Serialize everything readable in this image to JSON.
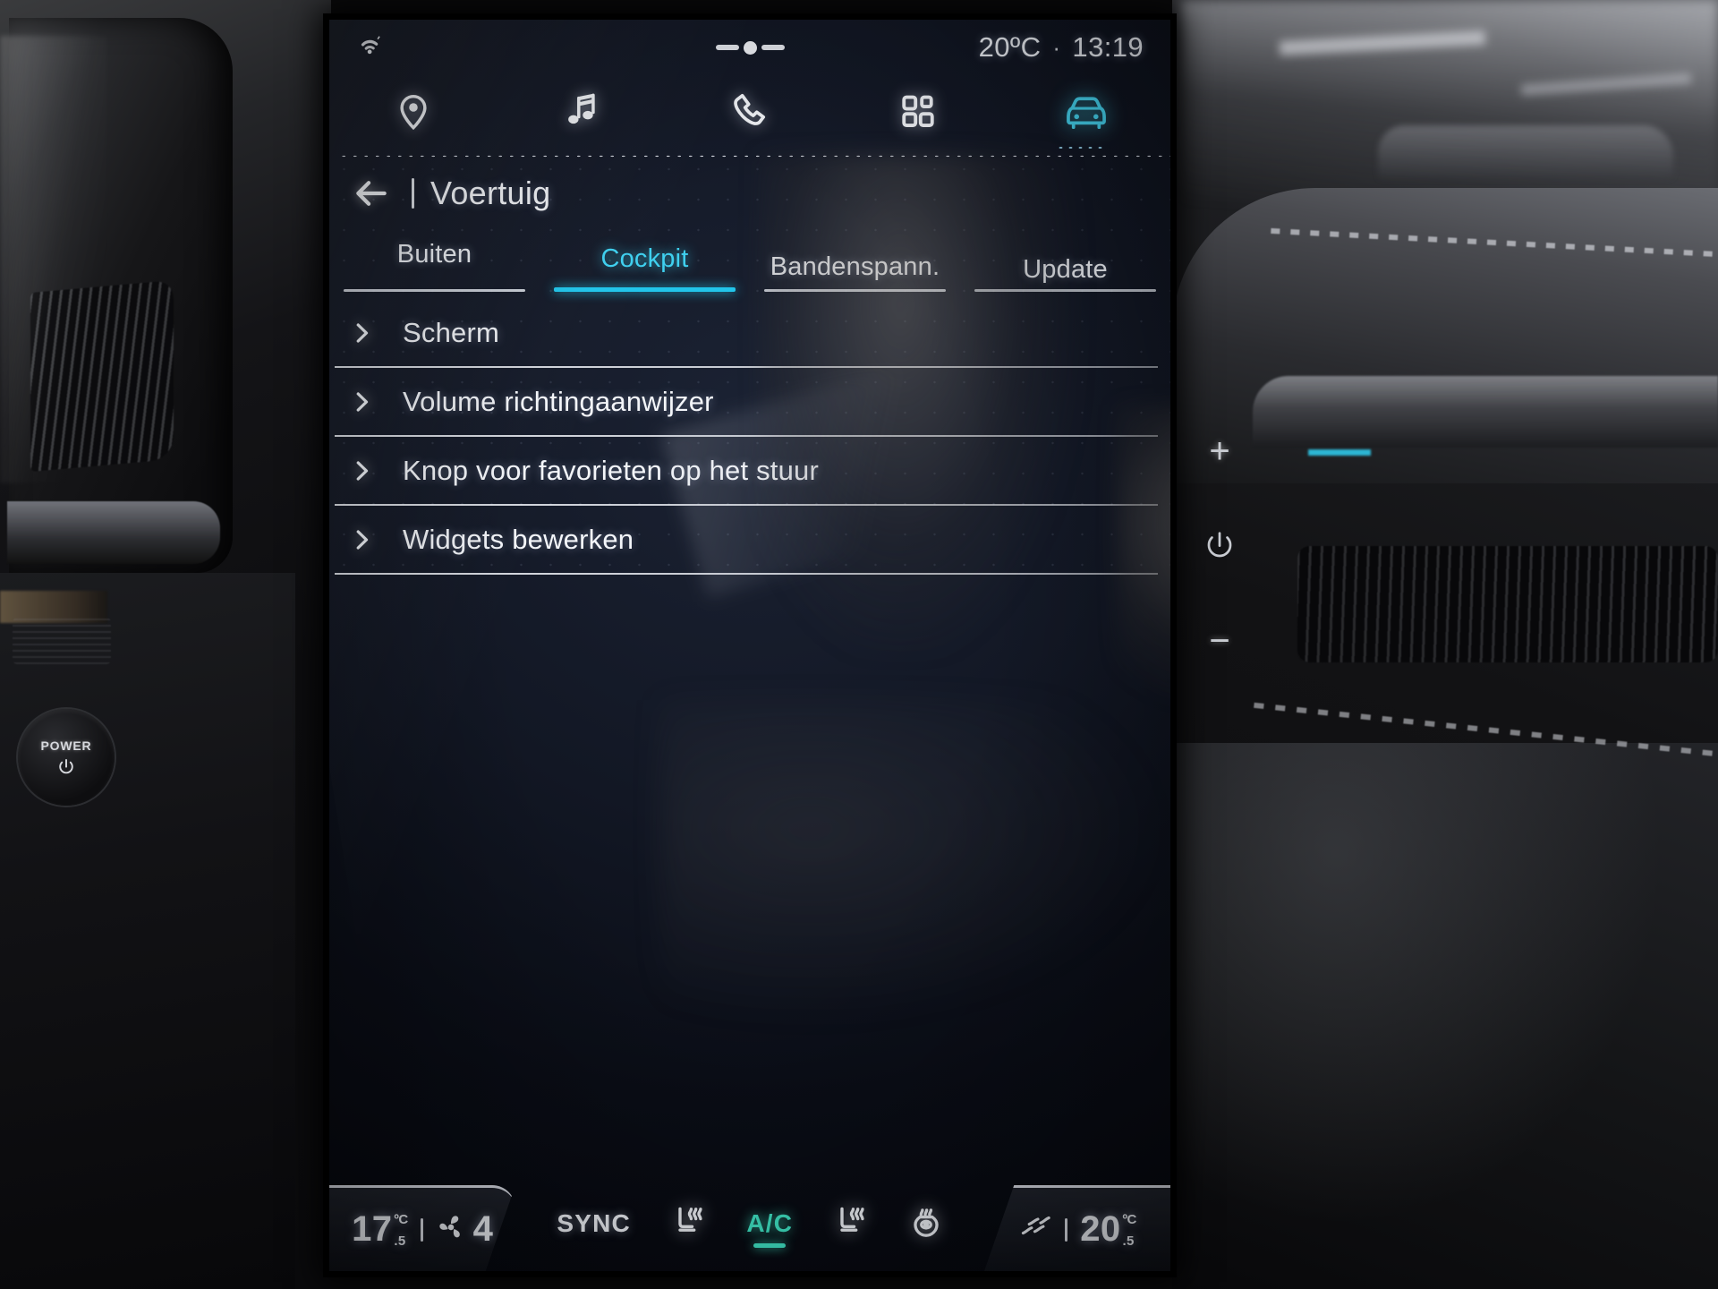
{
  "status_bar": {
    "wifi_icon": "wifi-icon",
    "handle_icon": "drag-handle-icon",
    "temperature": "20ºC",
    "separator": "·",
    "time": "13:19"
  },
  "nav_bar": {
    "items": [
      {
        "icon": "location-pin-icon",
        "name": "navigation",
        "active": false
      },
      {
        "icon": "music-note-icon",
        "name": "media",
        "active": false
      },
      {
        "icon": "phone-icon",
        "name": "phone",
        "active": false
      },
      {
        "icon": "apps-grid-icon",
        "name": "apps",
        "active": false
      },
      {
        "icon": "car-icon",
        "name": "vehicle",
        "active": true
      }
    ],
    "active_index": 4
  },
  "header": {
    "back_icon": "back-arrow-icon",
    "title": "Voertuig"
  },
  "tabs": [
    {
      "label": "Buiten",
      "active": false
    },
    {
      "label": "Cockpit",
      "active": true
    },
    {
      "label": "Bandenspann.",
      "active": false
    },
    {
      "label": "Update",
      "active": false
    }
  ],
  "list": {
    "items": [
      {
        "label": "Scherm",
        "chevron": "chevron-right-icon"
      },
      {
        "label": "Volume richtingaanwijzer",
        "chevron": "chevron-right-icon"
      },
      {
        "label": "Knop voor favorieten op het stuur",
        "chevron": "chevron-right-icon"
      },
      {
        "label": "Widgets bewerken",
        "chevron": "chevron-right-icon"
      }
    ]
  },
  "climate_bar": {
    "left_temp": {
      "value": "17",
      "unit": "ºC",
      "half": ".5"
    },
    "fan": {
      "icon": "fan-icon",
      "level": "4"
    },
    "buttons": [
      {
        "label": "SYNC",
        "icon": null,
        "active": false
      },
      {
        "label": null,
        "icon": "seat-heat-left-icon",
        "active": false
      },
      {
        "label": "A/C",
        "icon": null,
        "active": true
      },
      {
        "label": null,
        "icon": "seat-heat-right-icon",
        "active": false
      },
      {
        "label": null,
        "icon": "rear-defrost-icon",
        "active": false
      }
    ],
    "right_icon": "auto-climate-icon",
    "right_temp": {
      "value": "20",
      "unit": "ºC",
      "half": ".5"
    }
  },
  "hardware": {
    "power_button_label": "POWER",
    "power_button_icon": "power-icon",
    "bezel": [
      {
        "icon": "plus-icon",
        "label": "+"
      },
      {
        "icon": "power-icon",
        "label": ""
      },
      {
        "icon": "minus-icon",
        "label": "−"
      }
    ]
  },
  "colors": {
    "accent_cyan": "#22c5ea",
    "accent_teal": "#3fe3c4",
    "text_primary": "#f3f5f9",
    "screen_bg": "#0a0d16"
  }
}
